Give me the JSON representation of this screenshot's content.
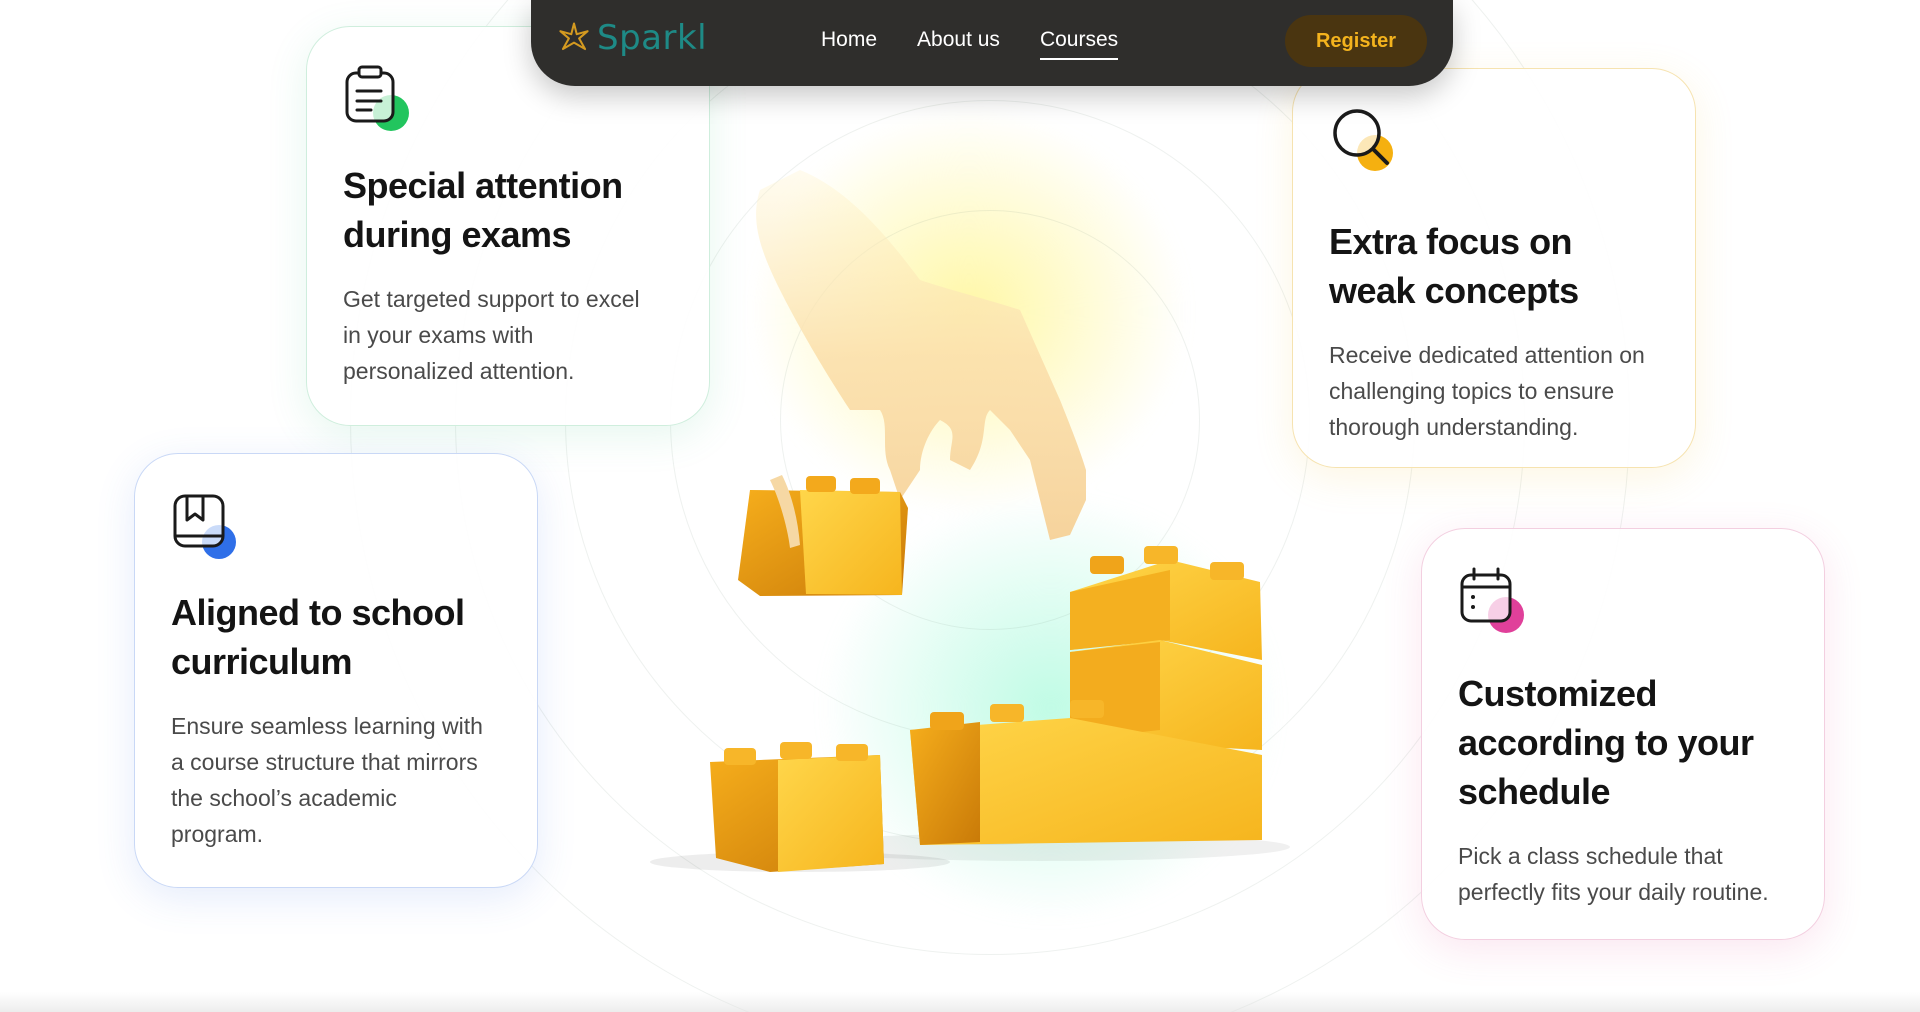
{
  "nav": {
    "brand": "Sparkl",
    "links": [
      "Home",
      "About us",
      "Courses"
    ],
    "active_link": "Courses",
    "register_label": "Register",
    "colors": {
      "bar": "#2f2e2c",
      "brand": "#1e8a86",
      "register_text": "#f4b31d",
      "register_bg": "#4a3510"
    }
  },
  "cards": {
    "exams": {
      "icon": "clipboard-icon",
      "accent": "#22c55e",
      "title_lines": [
        "Special attention",
        "during exams"
      ],
      "description_lines": [
        "Get targeted support to excel",
        "in your exams with",
        "personalized attention."
      ]
    },
    "weak": {
      "icon": "magnifier-icon",
      "accent": "#f5b010",
      "title_lines": [
        "Extra focus on",
        "weak concepts"
      ],
      "description_lines": [
        "Receive dedicated attention on",
        "challenging topics to ensure",
        "thorough understanding."
      ]
    },
    "curriculum": {
      "icon": "book-icon",
      "accent": "#2f6fe8",
      "title_lines": [
        "Aligned to school",
        "curriculum"
      ],
      "description_lines": [
        "Ensure seamless learning with",
        "a course structure that mirrors",
        "the school’s academic",
        "program."
      ]
    },
    "schedule": {
      "icon": "calendar-icon",
      "accent": "#e0409a",
      "title_lines": [
        "Customized",
        "according to your",
        "schedule"
      ],
      "description_lines": [
        "Pick a class schedule that",
        "perfectly fits your daily routine."
      ]
    }
  },
  "hero": {
    "illustration": "hand-placing-building-blocks-illustration"
  }
}
